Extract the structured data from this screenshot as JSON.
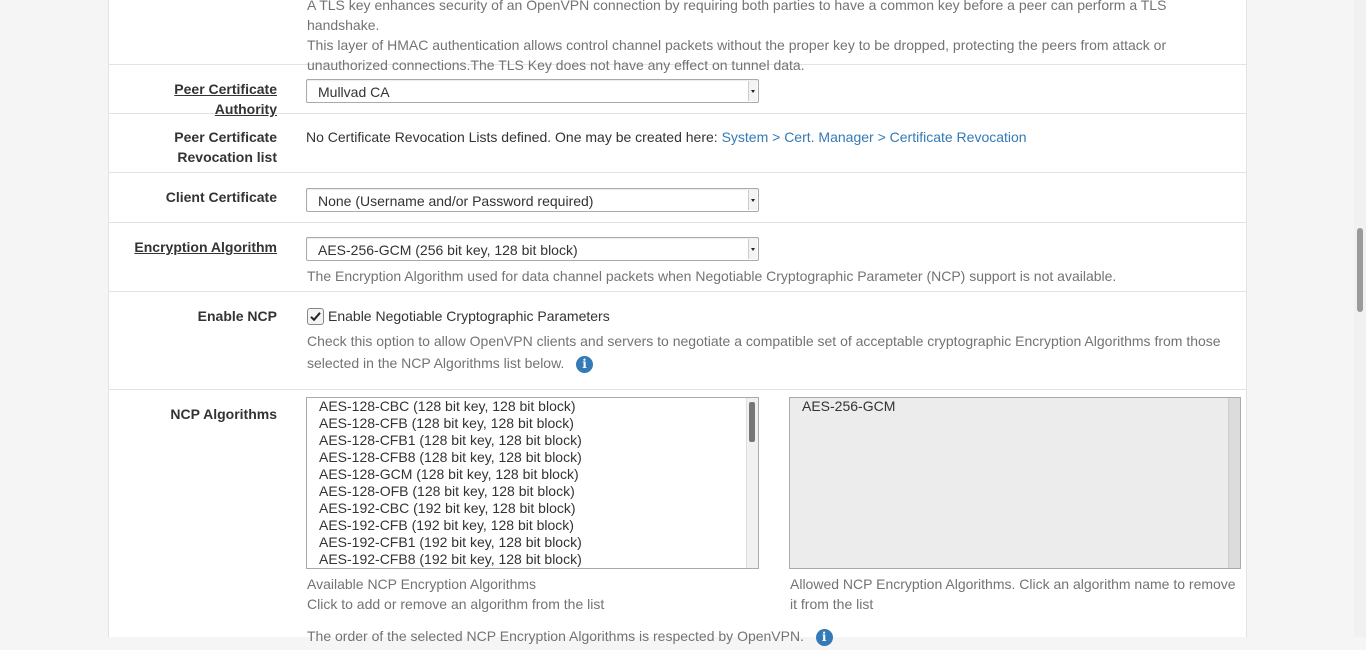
{
  "tls_help": {
    "line1": "A TLS key enhances security of an OpenVPN connection by requiring both parties to have a common key before a peer can perform a TLS handshake.",
    "line2": "This layer of HMAC authentication allows control channel packets without the proper key to be dropped, protecting the peers from attack or",
    "line3": "unauthorized connections.The TLS Key does not have any effect on tunnel data."
  },
  "peer_ca": {
    "label": "Peer Certificate Authority",
    "value": "Mullvad CA"
  },
  "peer_crl": {
    "label_line1": "Peer Certificate",
    "label_line2": "Revocation list",
    "text": "No Certificate Revocation Lists defined. One may be created here: ",
    "link": "System > Cert. Manager > Certificate Revocation"
  },
  "client_cert": {
    "label": "Client Certificate",
    "value": "None (Username and/or Password required)"
  },
  "encryption": {
    "label": "Encryption Algorithm",
    "value": "AES-256-GCM (256 bit key, 128 bit block)",
    "help": "The Encryption Algorithm used for data channel packets when Negotiable Cryptographic Parameter (NCP) support is not available."
  },
  "enable_ncp": {
    "label": "Enable NCP",
    "checked": true,
    "checkbox_label": "Enable Negotiable Cryptographic Parameters",
    "help_line1": "Check this option to allow OpenVPN clients and servers to negotiate a compatible set of acceptable cryptographic Encryption Algorithms from those",
    "help_line2": "selected in the NCP Algorithms list below."
  },
  "ncp_algorithms": {
    "label": "NCP Algorithms",
    "available": [
      "AES-128-CBC (128 bit key, 128 bit block)",
      "AES-128-CFB (128 bit key, 128 bit block)",
      "AES-128-CFB1 (128 bit key, 128 bit block)",
      "AES-128-CFB8 (128 bit key, 128 bit block)",
      "AES-128-GCM (128 bit key, 128 bit block)",
      "AES-128-OFB (128 bit key, 128 bit block)",
      "AES-192-CBC (192 bit key, 128 bit block)",
      "AES-192-CFB (192 bit key, 128 bit block)",
      "AES-192-CFB1 (192 bit key, 128 bit block)",
      "AES-192-CFB8 (192 bit key, 128 bit block)"
    ],
    "allowed": [
      "AES-256-GCM"
    ],
    "available_help_line1": "Available NCP Encryption Algorithms",
    "available_help_line2": "Click to add or remove an algorithm from the list",
    "allowed_help_line1": "Allowed NCP Encryption Algorithms. Click an algorithm name to remove",
    "allowed_help_line2": "it from the list",
    "order_note": "The order of the selected NCP Encryption Algorithms is respected by OpenVPN."
  },
  "icons": {
    "info": "info-circle-icon",
    "check": "check-icon",
    "dropdown": "chevron-down-icon"
  },
  "colors": {
    "link": "#337ab7",
    "info": "#337ab7",
    "help_text": "#737373"
  }
}
